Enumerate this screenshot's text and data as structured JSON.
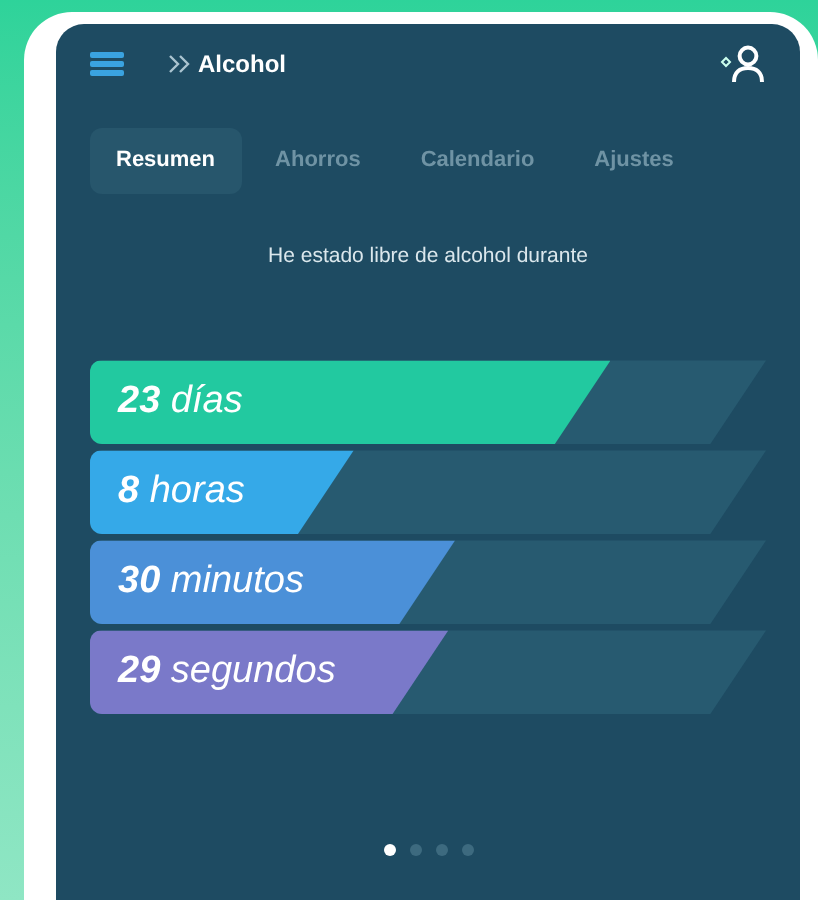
{
  "header": {
    "title": "Alcohol"
  },
  "tabs": [
    {
      "label": "Resumen",
      "selected": true
    },
    {
      "label": "Ahorros",
      "selected": false
    },
    {
      "label": "Calendario",
      "selected": false
    },
    {
      "label": "Ajustes",
      "selected": false
    }
  ],
  "caption": "He estado libre de alcohol durante",
  "counters": [
    {
      "text": "**23** días",
      "level": 0.77,
      "color": "#22c9a0"
    },
    {
      "text": "**8** horas",
      "level": 0.39,
      "color": "#35a9e8"
    },
    {
      "text": "**30** minutos",
      "level": 0.54,
      "color": "#4b90d8"
    },
    {
      "text": "**29** segundos",
      "level": 0.53,
      "color": "#7a79c9"
    }
  ],
  "pages": [
    {
      "selected": true
    },
    {
      "selected": false
    },
    {
      "selected": false
    },
    {
      "selected": false
    }
  ]
}
